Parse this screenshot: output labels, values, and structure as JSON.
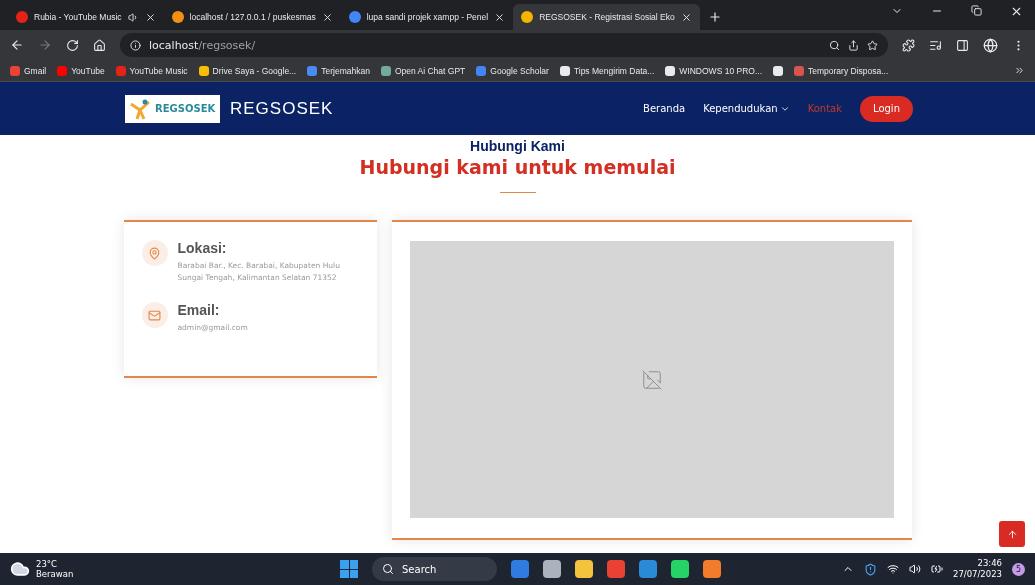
{
  "browser": {
    "tabs": [
      {
        "title": "Rubia - YouTube Music",
        "color": "#e62117",
        "audio": true,
        "selected": false
      },
      {
        "title": "localhost / 127.0.0.1 / puskesmas",
        "color": "#f29111",
        "audio": false,
        "selected": false
      },
      {
        "title": "lupa sandi projek xampp - Penel",
        "color": "#4285f4",
        "audio": false,
        "selected": false
      },
      {
        "title": "REGSOSEK - Registrasi Sosial Eko",
        "color": "#f4b400",
        "audio": false,
        "selected": true
      }
    ],
    "address": {
      "host": "localhost",
      "path": "/regsosek/"
    },
    "bookmarks": [
      {
        "label": "Gmail",
        "color": "#ea4335"
      },
      {
        "label": "YouTube",
        "color": "#ff0000"
      },
      {
        "label": "YouTube Music",
        "color": "#e62117"
      },
      {
        "label": "Drive Saya - Google...",
        "color": "#fbbc04"
      },
      {
        "label": "Terjemahkan",
        "color": "#4a8af4"
      },
      {
        "label": "Open Ai Chat GPT",
        "color": "#74aa9c"
      },
      {
        "label": "Google Scholar",
        "color": "#4285f4"
      },
      {
        "label": "Tips Mengirim Data...",
        "color": "#e8eaed"
      },
      {
        "label": "WINDOWS 10 PRO...",
        "color": "#e8eaed"
      },
      {
        "color": "#e8eaed"
      },
      {
        "label": "Temporary Disposa...",
        "color": "#d9534f"
      }
    ]
  },
  "site": {
    "logo_text": "REGSOSEK",
    "brand": "REGSOSEK",
    "nav": [
      {
        "label": "Beranda",
        "dropdown": false,
        "selected": false
      },
      {
        "label": "Kependudukan",
        "dropdown": true,
        "selected": false
      },
      {
        "label": "Kontak",
        "dropdown": false,
        "selected": true
      }
    ],
    "login": "Login",
    "section": {
      "subtitle": "Hubungi Kami",
      "title": "Hubungi kami untuk memulai"
    },
    "info": [
      {
        "kind": "location",
        "label": "Lokasi:",
        "value": "Barabai Bar., Kec. Barabai, Kabupaten Hulu Sungai Tengah, Kalimantan Selatan 71352"
      },
      {
        "kind": "email",
        "label": "Email:",
        "value": "admin@gmail.com"
      }
    ]
  },
  "taskbar": {
    "temperature": "23°C",
    "weather": "Berawan",
    "search": "Search",
    "time": "23:46",
    "date": "27/07/2023",
    "notifications": "5"
  }
}
